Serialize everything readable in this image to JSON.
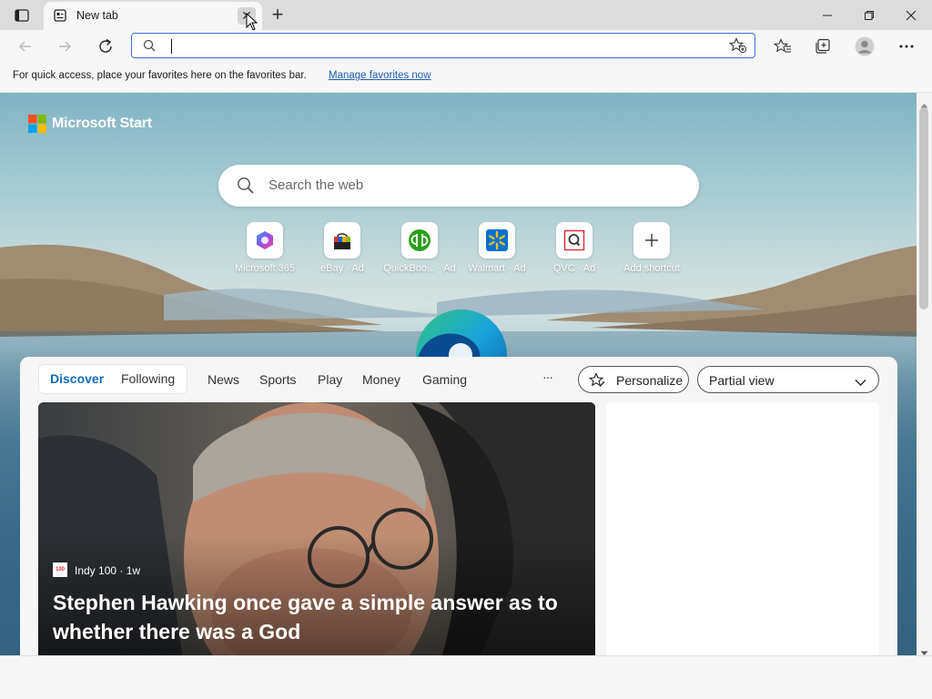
{
  "tabstrip": {
    "tab_title": "New tab",
    "close_glyph": "✕",
    "new_tab_glyph": "+"
  },
  "window_controls": {
    "minimize": "—",
    "restore": "❐",
    "close": "✕"
  },
  "address_bar": {
    "value": "",
    "placeholder": ""
  },
  "favorites_bar": {
    "message": "For quick access, place your favorites here on the favorites bar.",
    "link": "Manage favorites now"
  },
  "brand": {
    "name": "Microsoft Start"
  },
  "search": {
    "placeholder": "Search the web"
  },
  "shortcuts": [
    {
      "label": "Microsoft 365",
      "icon": "microsoft-365-icon"
    },
    {
      "label": "eBay · Ad",
      "icon": "ebay-icon"
    },
    {
      "label": "QuickBoo... · Ad",
      "icon": "quickbooks-icon"
    },
    {
      "label": "Walmart · Ad",
      "icon": "walmart-icon"
    },
    {
      "label": "QVC · Ad",
      "icon": "qvc-icon"
    },
    {
      "label": "Add shortcut",
      "icon": "plus-icon"
    }
  ],
  "feed_nav": {
    "discover": "Discover",
    "following": "Following",
    "items": [
      "News",
      "Sports",
      "Play",
      "Money",
      "Gaming"
    ],
    "more": "···",
    "personalize": "Personalize",
    "view_select": "Partial view"
  },
  "hero": {
    "source": "Indy 100 · 1w",
    "source_logo_text": "100",
    "headline": "Stephen Hawking once gave a simple answer as to whether there was a God"
  },
  "colors": {
    "accent": "#0f6cbd",
    "link": "#1a5fb4"
  }
}
